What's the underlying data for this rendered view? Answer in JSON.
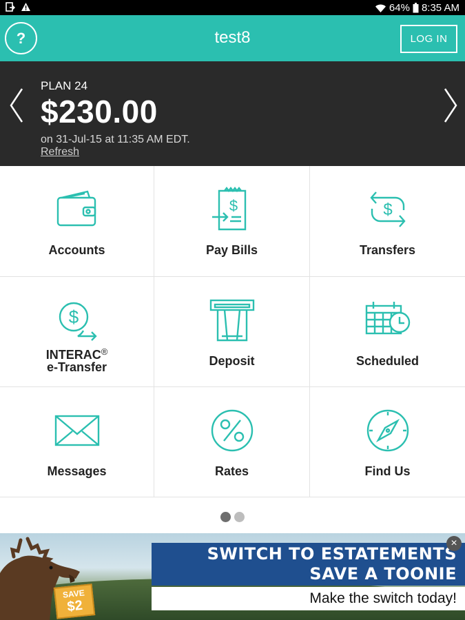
{
  "status_bar": {
    "battery": "64%",
    "time": "8:35 AM",
    "icons": [
      "screenshot-icon",
      "warning-icon",
      "wifi-icon",
      "battery-icon"
    ]
  },
  "header": {
    "help_label": "?",
    "title": "test8",
    "login_label": "LOG IN",
    "color": "#2bbfb0"
  },
  "balance": {
    "plan": "PLAN 24",
    "amount": "$230.00",
    "date": "on 31-Jul-15 at 11:35 AM EDT.",
    "refresh": "Refresh"
  },
  "menu": [
    {
      "label": "Accounts",
      "icon": "wallet-icon"
    },
    {
      "label": "Pay Bills",
      "icon": "bill-icon"
    },
    {
      "label": "Transfers",
      "icon": "transfer-icon"
    },
    {
      "label": "INTERAC",
      "label2": "e-Transfer",
      "sup": "®",
      "icon": "etransfer-icon"
    },
    {
      "label": "Deposit",
      "icon": "deposit-icon"
    },
    {
      "label": "Scheduled",
      "icon": "calendar-clock-icon"
    },
    {
      "label": "Messages",
      "icon": "envelope-icon"
    },
    {
      "label": "Rates",
      "icon": "percent-icon"
    },
    {
      "label": "Find Us",
      "icon": "compass-icon"
    }
  ],
  "pager": {
    "pages": 2,
    "active": 1
  },
  "ad": {
    "headline_1": "SWITCH TO ESTATEMENTS",
    "headline_2": "SAVE A TOONIE",
    "cta": "Make the switch today!",
    "badge_top": "SAVE",
    "badge_value": "$2",
    "close": "×"
  }
}
